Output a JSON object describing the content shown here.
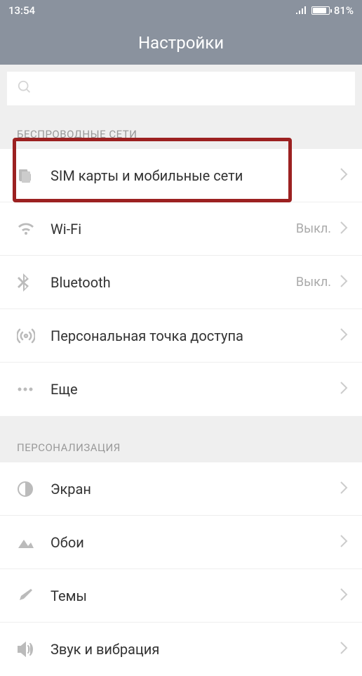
{
  "statusBar": {
    "time": "13:54",
    "battery": "81%"
  },
  "header": {
    "title": "Настройки"
  },
  "sections": [
    {
      "header": "БЕСПРОВОДНЫЕ СЕТИ",
      "items": [
        {
          "label": "SIM карты и мобильные сети",
          "value": ""
        },
        {
          "label": "Wi-Fi",
          "value": "Выкл."
        },
        {
          "label": "Bluetooth",
          "value": "Выкл."
        },
        {
          "label": "Персональная точка доступа",
          "value": ""
        },
        {
          "label": "Еще",
          "value": ""
        }
      ]
    },
    {
      "header": "ПЕРСОНАЛИЗАЦИЯ",
      "items": [
        {
          "label": "Экран",
          "value": ""
        },
        {
          "label": "Обои",
          "value": ""
        },
        {
          "label": "Темы",
          "value": ""
        },
        {
          "label": "Звук и вибрация",
          "value": ""
        }
      ]
    }
  ]
}
